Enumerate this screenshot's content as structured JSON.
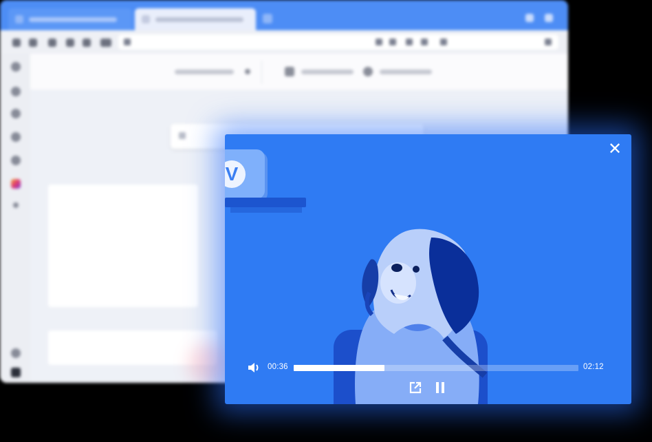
{
  "player": {
    "current_time": "00:36",
    "duration": "02:12",
    "progress": 0.32,
    "close_icon": "close-icon",
    "volume_icon": "volume-icon",
    "popout_icon": "open-external-icon",
    "pause_icon": "pause-icon",
    "accent_color": "#2f7bf3"
  },
  "browser": {
    "tabbar_color": "#4d8df5"
  }
}
